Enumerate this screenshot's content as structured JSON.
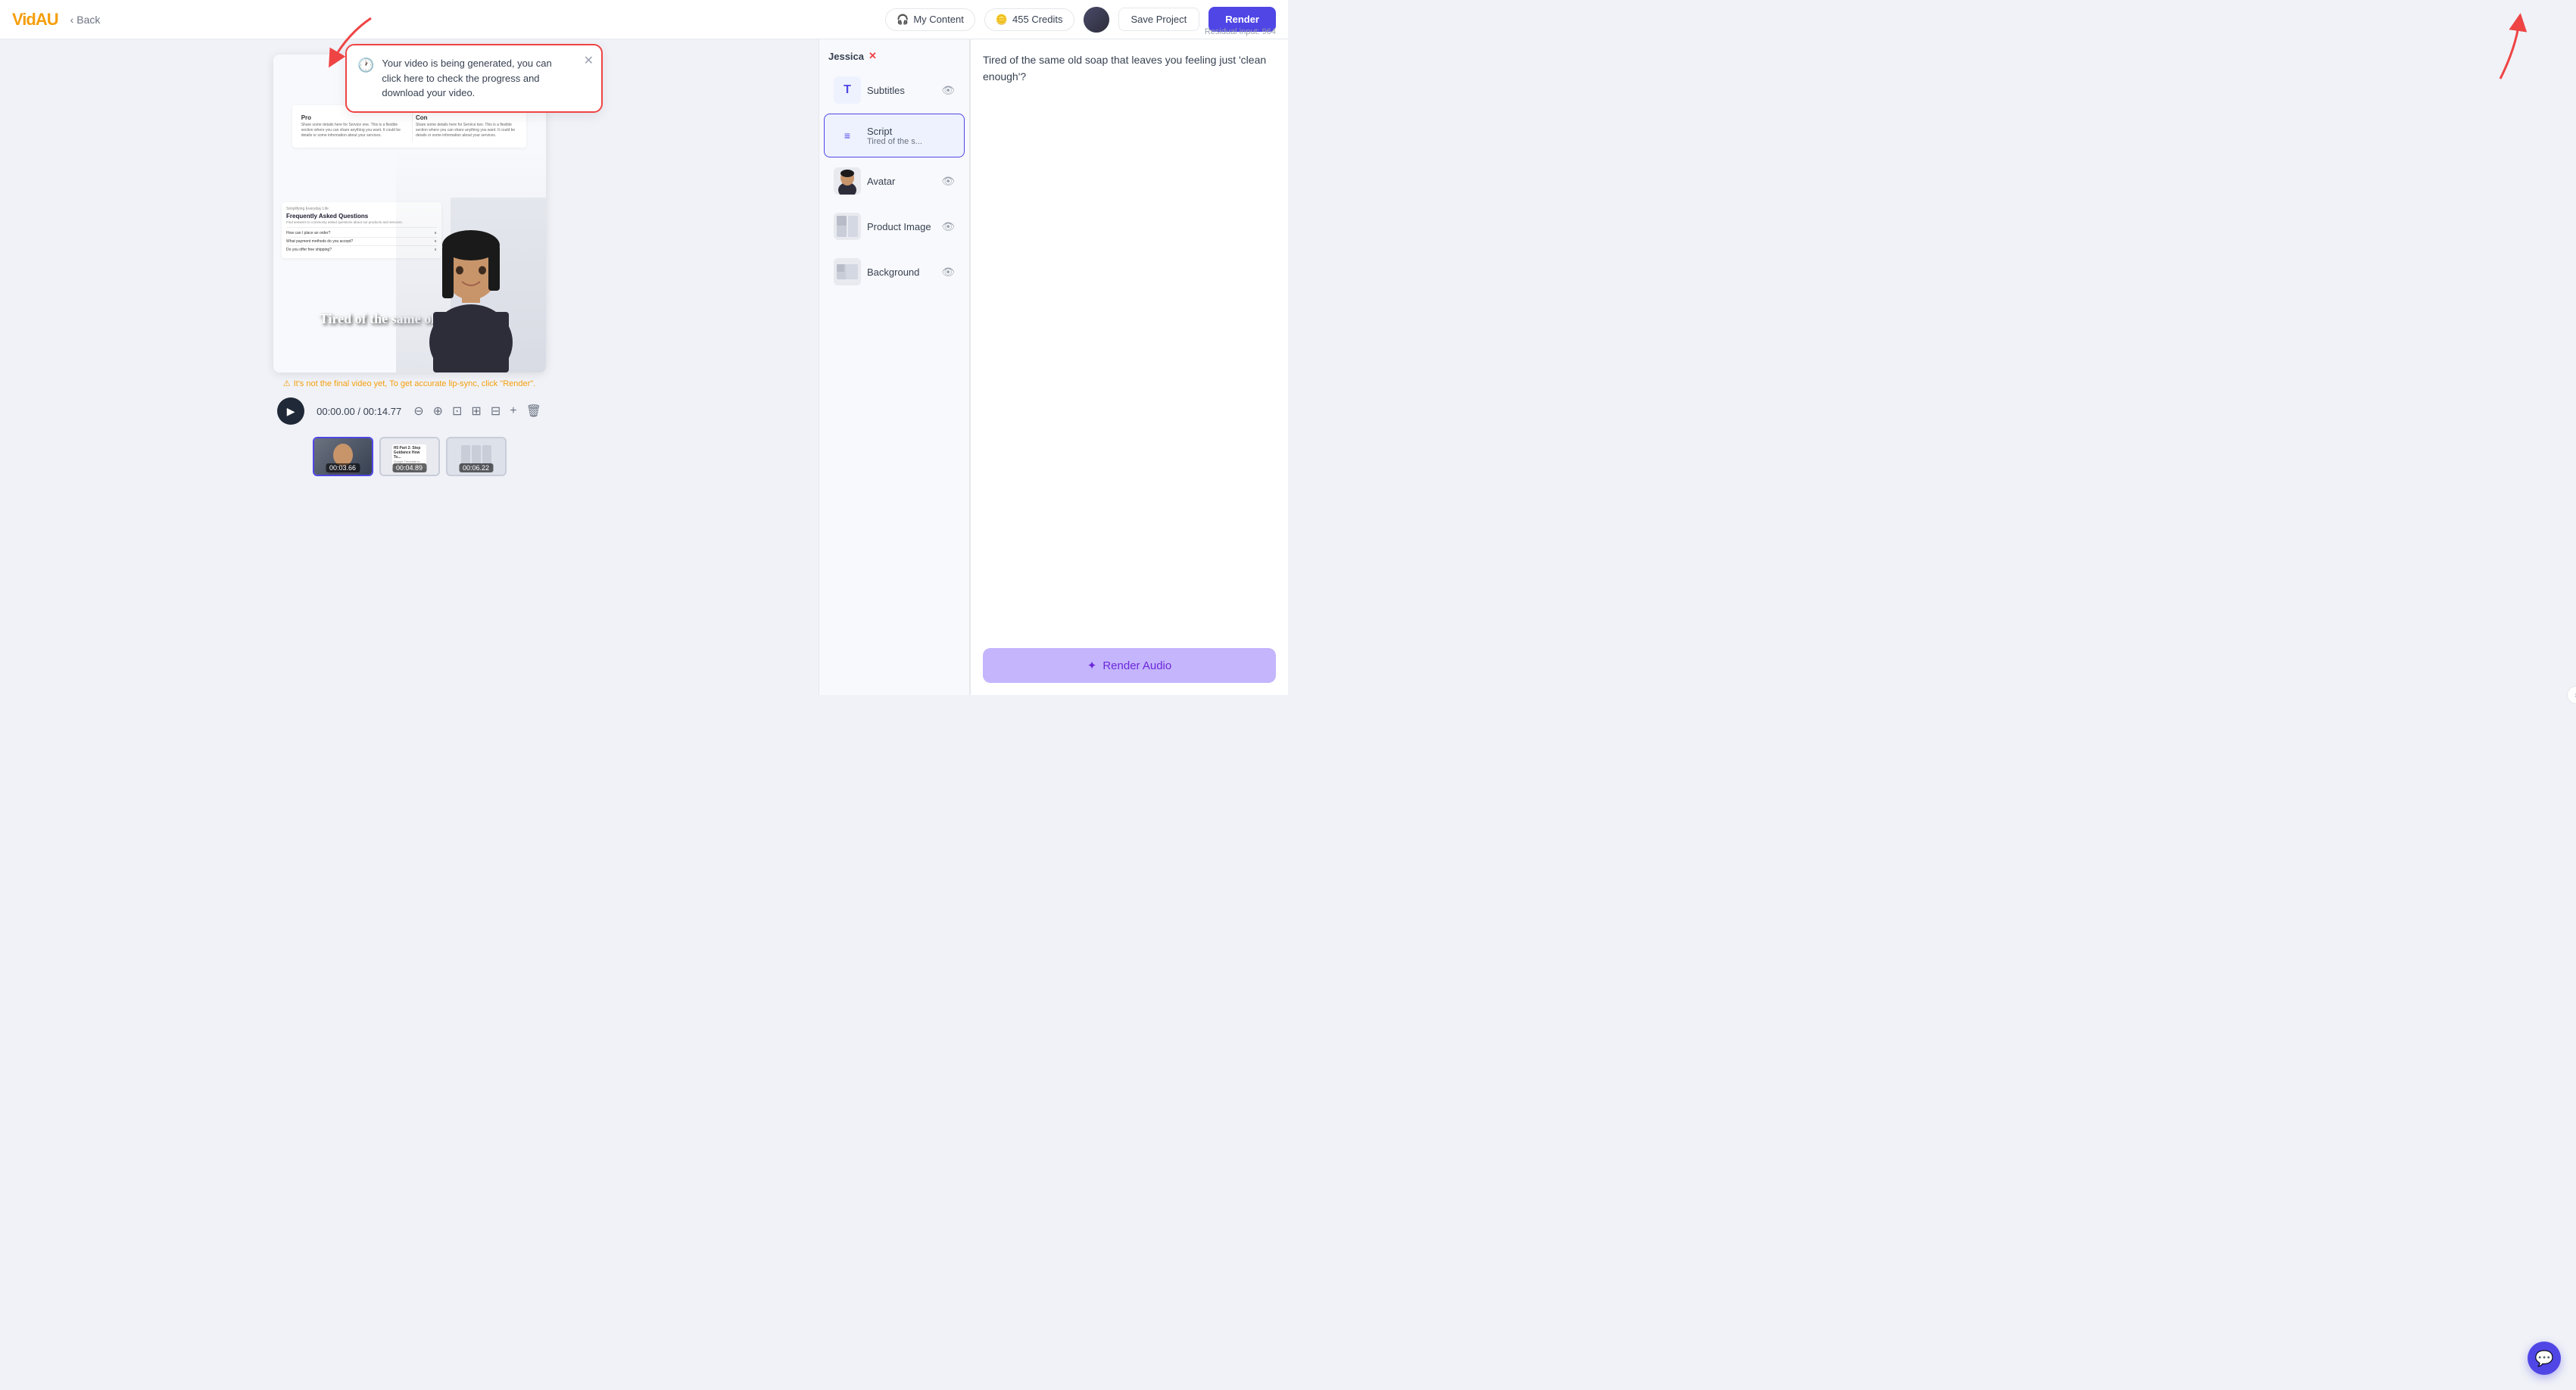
{
  "header": {
    "logo": "VidAU",
    "back_label": "Back",
    "my_content_label": "My Content",
    "credits_label": "455 Credits",
    "save_project_label": "Save Project",
    "render_label": "Render",
    "residual_label": "Residual input: 964"
  },
  "notification": {
    "message": "Your video is being generated, you can click here to check the progress and download your video."
  },
  "video": {
    "current_time": "00:00.00",
    "total_time": "00:14.77",
    "warning_text": "It's not the final video yet, To get accurate lip-sync, click \"Render\".",
    "subtitle_text": "Tired of the same old soap that"
  },
  "timeline": {
    "thumbs": [
      {
        "time": "00:03.66",
        "active": true
      },
      {
        "time": "00:04.89",
        "active": false
      },
      {
        "time": "00:06.22",
        "active": false
      }
    ]
  },
  "layers": {
    "scene_name": "Jessica",
    "items": [
      {
        "id": "subtitles",
        "label": "Subtitles",
        "icon": "T",
        "active": false
      },
      {
        "id": "script",
        "label": "Script",
        "sublabel": "Tired of the s...",
        "icon": "≡",
        "active": true
      },
      {
        "id": "avatar",
        "label": "Avatar",
        "icon": "👤",
        "active": false
      },
      {
        "id": "product-image",
        "label": "Product Image",
        "icon": "🖼",
        "active": false
      },
      {
        "id": "background",
        "label": "Background",
        "icon": "🏞",
        "active": false
      }
    ]
  },
  "properties": {
    "script_text": "Tired of the same old soap that leaves you feeling just 'clean enough'?",
    "render_audio_label": "✦ Render Audio"
  },
  "slide1": {
    "pro_header": "Pro",
    "con_header": "Con",
    "pro_text": "Share some details here for Service one. This is a flexible section where you can share anything you want. It could be details or some information about your services.",
    "con_text": "Share some details here for Service two. This is a flexible section where you can share anything you want. It could be details or some information about your services."
  },
  "slide2": {
    "company_tag": "Simplifying Everyday Life",
    "title": "Frequently Asked Questions",
    "subtitle": "Find answers to commonly asked questions about our products and services.",
    "items": [
      "How can I place an order?",
      "What payment methods do you accept?",
      "Do you offer free shipping?"
    ]
  }
}
